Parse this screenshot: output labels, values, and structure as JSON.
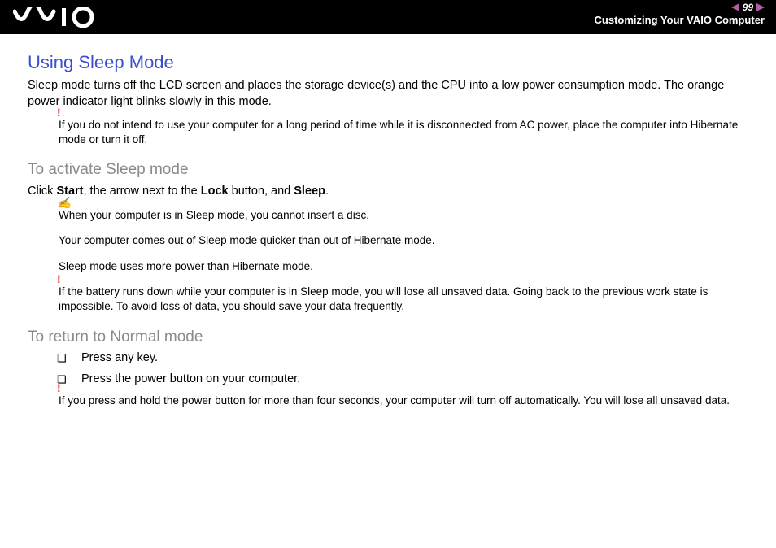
{
  "header": {
    "page_number": "99",
    "section_title": "Customizing Your VAIO Computer"
  },
  "main": {
    "title": "Using Sleep Mode",
    "intro": "Sleep mode turns off the LCD screen and places the storage device(s) and the CPU into a low power consumption mode. The orange power indicator light blinks slowly in this mode.",
    "warning1": "If you do not intend to use your computer for a long period of time while it is disconnected from AC power, place the computer into Hibernate mode or turn it off.",
    "section1": {
      "heading": "To activate Sleep mode",
      "instruction_parts": {
        "p1": "Click ",
        "b1": "Start",
        "p2": ", the arrow next to the ",
        "b2": "Lock",
        "p3": " button, and ",
        "b3": "Sleep",
        "p4": "."
      },
      "note1": "When your computer is in Sleep mode, you cannot insert a disc.",
      "note2": "Your computer comes out of Sleep mode quicker than out of Hibernate mode.",
      "note3": "Sleep mode uses more power than Hibernate mode.",
      "warning2": "If the battery runs down while your computer is in Sleep mode, you will lose all unsaved data. Going back to the previous work state is impossible. To avoid loss of data, you should save your data frequently."
    },
    "section2": {
      "heading": "To return to Normal mode",
      "items": [
        "Press any key.",
        "Press the power button on your computer."
      ],
      "warning3": "If you press and hold the power button for more than four seconds, your computer will turn off automatically. You will lose all unsaved data."
    }
  }
}
